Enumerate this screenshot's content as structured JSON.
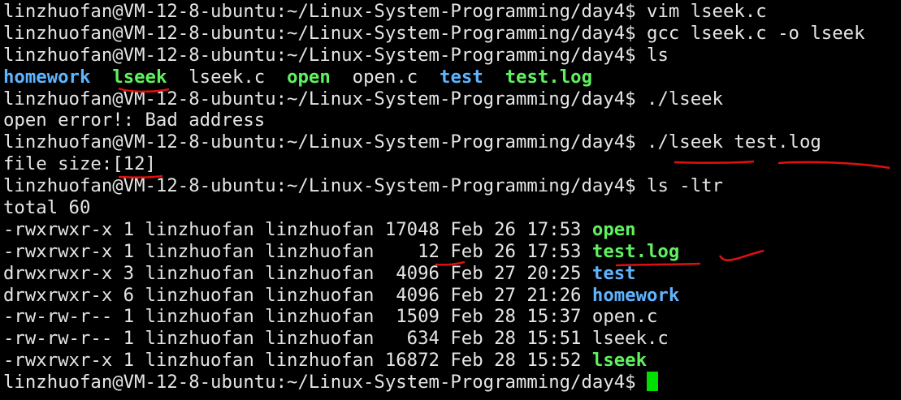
{
  "prompt": "linzhuofan@VM-12-8-ubuntu:~/Linux-System-Programming/day4$ ",
  "lines": [
    {
      "type": "cmd",
      "text": "vim lseek.c"
    },
    {
      "type": "cmd",
      "text": "gcc lseek.c -o lseek"
    },
    {
      "type": "cmd",
      "text": "ls"
    },
    {
      "type": "ls",
      "items": [
        {
          "name": "homework",
          "kind": "dir"
        },
        {
          "name": "lseek",
          "kind": "exe"
        },
        {
          "name": "lseek.c",
          "kind": "file"
        },
        {
          "name": "open",
          "kind": "exe"
        },
        {
          "name": "open.c",
          "kind": "file"
        },
        {
          "name": "test",
          "kind": "dir"
        },
        {
          "name": "test.log",
          "kind": "exe"
        }
      ]
    },
    {
      "type": "cmd",
      "text": "./lseek"
    },
    {
      "type": "out",
      "text": "open error!: Bad address"
    },
    {
      "type": "cmd",
      "text": "./lseek test.log"
    },
    {
      "type": "out",
      "text": "file size:[12]"
    },
    {
      "type": "cmd",
      "text": "ls -ltr"
    },
    {
      "type": "out",
      "text": "total 60"
    },
    {
      "type": "long",
      "meta": "-rwxrwxr-x 1 linzhuofan linzhuofan 17048 Feb 26 17:53 ",
      "name": "open",
      "kind": "exe"
    },
    {
      "type": "long",
      "meta": "-rwxrwxr-x 1 linzhuofan linzhuofan    12 Feb 26 17:53 ",
      "name": "test.log",
      "kind": "exe"
    },
    {
      "type": "long",
      "meta": "drwxrwxr-x 3 linzhuofan linzhuofan  4096 Feb 27 20:25 ",
      "name": "test",
      "kind": "dir"
    },
    {
      "type": "long",
      "meta": "drwxrwxr-x 6 linzhuofan linzhuofan  4096 Feb 27 21:26 ",
      "name": "homework",
      "kind": "dir"
    },
    {
      "type": "long",
      "meta": "-rw-rw-r-- 1 linzhuofan linzhuofan  1509 Feb 28 15:37 ",
      "name": "open.c",
      "kind": "file"
    },
    {
      "type": "long",
      "meta": "-rw-rw-r-- 1 linzhuofan linzhuofan   634 Feb 28 15:51 ",
      "name": "lseek.c",
      "kind": "file"
    },
    {
      "type": "long",
      "meta": "-rwxrwxr-x 1 linzhuofan linzhuofan 16872 Feb 28 15:52 ",
      "name": "lseek",
      "kind": "exe"
    },
    {
      "type": "cursor",
      "text": ""
    }
  ],
  "colors": {
    "background": "#000000",
    "text": "#e5e5e5",
    "directory": "#5fb4ff",
    "executable": "#5ff25f",
    "cursor": "#00e000",
    "annotation": "#e01010"
  }
}
